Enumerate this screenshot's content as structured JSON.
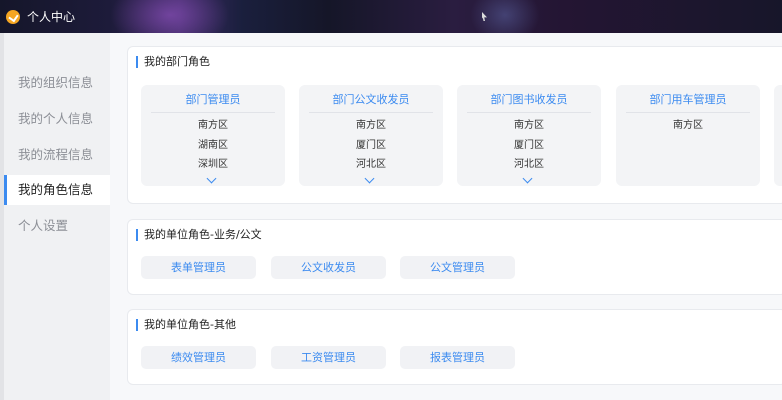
{
  "window": {
    "title": "个人中心"
  },
  "sidebar": {
    "items": [
      {
        "label": "我的组织信息"
      },
      {
        "label": "我的个人信息"
      },
      {
        "label": "我的流程信息"
      },
      {
        "label": "我的角色信息"
      },
      {
        "label": "个人设置"
      }
    ],
    "active_index": 3
  },
  "sections": {
    "dept_roles": {
      "title": "我的部门角色",
      "cards": [
        {
          "title": "部门管理员",
          "regions": [
            "南方区",
            "湖南区",
            "深圳区"
          ],
          "has_more": true
        },
        {
          "title": "部门公文收发员",
          "regions": [
            "南方区",
            "厦门区",
            "河北区"
          ],
          "has_more": true
        },
        {
          "title": "部门图书收发员",
          "regions": [
            "南方区",
            "厦门区",
            "河北区"
          ],
          "has_more": true
        },
        {
          "title": "部门用车管理员",
          "regions": [
            "南方区"
          ],
          "has_more": false
        }
      ]
    },
    "unit_business": {
      "title": "我的单位角色-业务/公文",
      "roles": [
        "表单管理员",
        "公文收发员",
        "公文管理员"
      ]
    },
    "unit_other": {
      "title": "我的单位角色-其他",
      "roles": [
        "绩效管理员",
        "工资管理员",
        "报表管理员"
      ]
    }
  },
  "colors": {
    "accent": "#3c8bf0",
    "logo": "#f5a623"
  }
}
